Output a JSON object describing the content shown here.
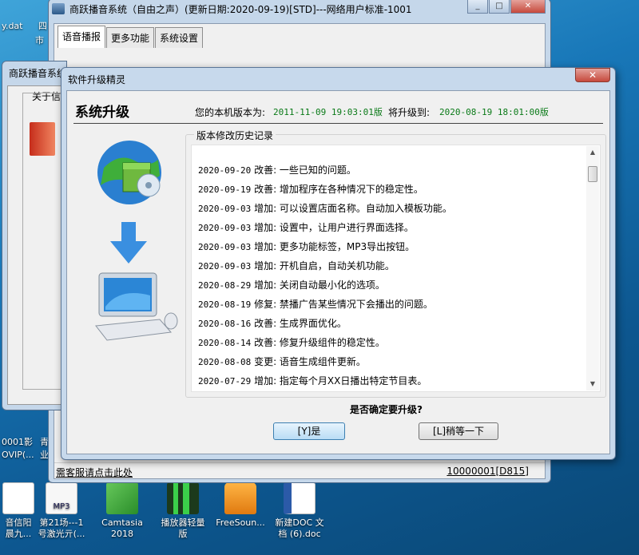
{
  "desktop": {
    "top_left_texts": [
      "y.dat",
      "市",
      "四"
    ],
    "mid_left_texts": [
      "0001影",
      "OVIP(...",
      "青",
      "业"
    ],
    "icons": [
      {
        "label_line1": "音信阳",
        "label_line2": "晨九...",
        "icon": "sound-file-icon"
      },
      {
        "label_line1": "第21场---1",
        "label_line2": "号激光亓(...",
        "icon": "mp3-file-icon"
      },
      {
        "label_line1": "Camtasia",
        "label_line2": "2018",
        "icon": "camtasia-icon"
      },
      {
        "label_line1": "播放器轻量",
        "label_line2": "版",
        "icon": "player-icon"
      },
      {
        "label_line1": "FreeSoun...",
        "label_line2": "",
        "icon": "lock-app-icon"
      },
      {
        "label_line1": "新建DOC 文",
        "label_line2": "档 (6).doc",
        "icon": "word-doc-icon"
      }
    ]
  },
  "main_window": {
    "title": "商跃播音系统（自由之声）(更新日期:2020-09-19)[STD]---网络用户标准-1001",
    "tabs": [
      "语音播报",
      "更多功能",
      "系统设置"
    ],
    "status_left": "需客服请点击此处",
    "status_right": "10000001[D815]"
  },
  "second_window": {
    "title": "商跃播音系统",
    "label": "关于信"
  },
  "dialog": {
    "title": "软件升级精灵",
    "close_label": "✕",
    "heading": "系统升级",
    "current_version_label": "您的本机版本为:",
    "current_version_value": "2011-11-09 19:03:01版",
    "upgrade_to_label": "将升级到:",
    "upgrade_to_value": "2020-08-19 18:01:00版",
    "history_group_label": "版本修改历史记录",
    "history": [
      {
        "date": "2020-09-20",
        "text": "改善: 一些已知的问题。"
      },
      {
        "date": "2020-09-19",
        "text": "改善: 增加程序在各种情况下的稳定性。"
      },
      {
        "date": "2020-09-03",
        "text": "增加: 可以设置店面名称。自动加入模板功能。"
      },
      {
        "date": "2020-09-03",
        "text": "增加: 设置中，让用户进行界面选择。"
      },
      {
        "date": "2020-09-03",
        "text": "增加: 更多功能标签，MP3导出按钮。"
      },
      {
        "date": "2020-09-03",
        "text": "增加: 开机自启，自动关机功能。"
      },
      {
        "date": "2020-08-29",
        "text": "增加: 关闭自动最小化的选项。"
      },
      {
        "date": "2020-08-19",
        "text": "修复: 禁播广告某些情况下会播出的问题。"
      },
      {
        "date": "2020-08-16",
        "text": "改善: 生成界面优化。"
      },
      {
        "date": "2020-08-14",
        "text": "改善: 修复升级组件的稳定性。"
      },
      {
        "date": "2020-08-08",
        "text": "变更: 语音生成组件更新。"
      },
      {
        "date": "2020-07-29",
        "text": "增加: 指定每个月XX日播出特定节目表。"
      }
    ],
    "question": "是否确定要升级?",
    "yes_button": "[Y]是",
    "later_button": "[L]稍等一下"
  }
}
